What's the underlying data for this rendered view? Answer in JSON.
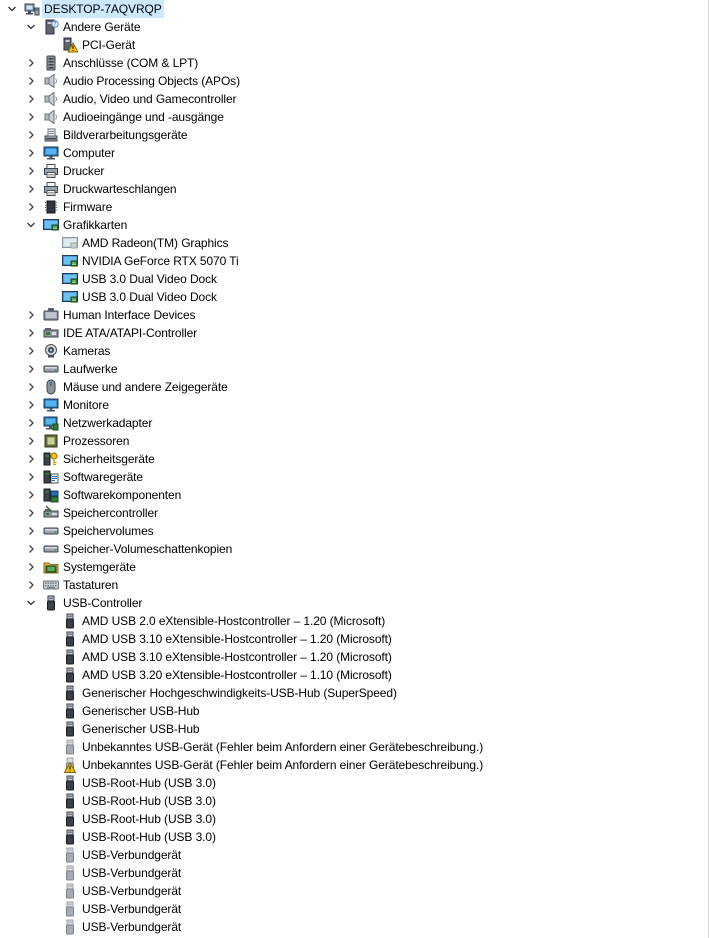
{
  "root": {
    "label": "DESKTOP-7AQVRQP",
    "icon": "computer-network-icon",
    "expanded": true
  },
  "tree": [
    {
      "label": "Andere Geräte",
      "icon": "unknown-device-icon",
      "expanded": true,
      "children": [
        {
          "label": "PCI-Gerät",
          "icon": "warning-device-icon"
        }
      ]
    },
    {
      "label": "Anschlüsse (COM & LPT)",
      "icon": "port-icon"
    },
    {
      "label": "Audio Processing Objects (APOs)",
      "icon": "speaker-icon"
    },
    {
      "label": "Audio, Video und Gamecontroller",
      "icon": "speaker-icon"
    },
    {
      "label": "Audioeingänge und -ausgänge",
      "icon": "speaker-icon"
    },
    {
      "label": "Bildverarbeitungsgeräte",
      "icon": "scanner-icon"
    },
    {
      "label": "Computer",
      "icon": "monitor-icon"
    },
    {
      "label": "Drucker",
      "icon": "printer-icon"
    },
    {
      "label": "Druckwarteschlangen",
      "icon": "printer-icon"
    },
    {
      "label": "Firmware",
      "icon": "chip-icon"
    },
    {
      "label": "Grafikkarten",
      "icon": "display-adapter-icon",
      "expanded": true,
      "children": [
        {
          "label": "AMD Radeon(TM) Graphics",
          "icon": "display-adapter-disabled-icon"
        },
        {
          "label": "NVIDIA GeForce RTX 5070 Ti",
          "icon": "display-adapter-icon"
        },
        {
          "label": "USB 3.0 Dual Video Dock",
          "icon": "display-adapter-icon"
        },
        {
          "label": "USB 3.0 Dual Video Dock",
          "icon": "display-adapter-icon"
        }
      ]
    },
    {
      "label": "Human Interface Devices",
      "icon": "hid-icon"
    },
    {
      "label": "IDE ATA/ATAPI-Controller",
      "icon": "ide-controller-icon"
    },
    {
      "label": "Kameras",
      "icon": "camera-icon"
    },
    {
      "label": "Laufwerke",
      "icon": "drive-icon"
    },
    {
      "label": "Mäuse und andere Zeigegeräte",
      "icon": "mouse-icon"
    },
    {
      "label": "Monitore",
      "icon": "monitor-icon"
    },
    {
      "label": "Netzwerkadapter",
      "icon": "network-icon"
    },
    {
      "label": "Prozessoren",
      "icon": "processor-icon"
    },
    {
      "label": "Sicherheitsgeräte",
      "icon": "security-key-icon"
    },
    {
      "label": "Softwaregeräte",
      "icon": "software-device-icon"
    },
    {
      "label": "Softwarekomponenten",
      "icon": "software-component-icon"
    },
    {
      "label": "Speichercontroller",
      "icon": "storage-controller-icon"
    },
    {
      "label": "Speichervolumes",
      "icon": "drive-icon"
    },
    {
      "label": "Speicher-Volumeschattenkopien",
      "icon": "drive-icon"
    },
    {
      "label": "Systemgeräte",
      "icon": "system-folder-icon"
    },
    {
      "label": "Tastaturen",
      "icon": "keyboard-icon"
    },
    {
      "label": "USB-Controller",
      "icon": "usb-icon",
      "expanded": true,
      "children": [
        {
          "label": "AMD USB 2.0 eXtensible-Hostcontroller – 1.20 (Microsoft)",
          "icon": "usb-icon"
        },
        {
          "label": "AMD USB 3.10 eXtensible-Hostcontroller – 1.20 (Microsoft)",
          "icon": "usb-icon"
        },
        {
          "label": "AMD USB 3.10 eXtensible-Hostcontroller – 1.20 (Microsoft)",
          "icon": "usb-icon"
        },
        {
          "label": "AMD USB 3.20 eXtensible-Hostcontroller – 1.10 (Microsoft)",
          "icon": "usb-icon"
        },
        {
          "label": "Generischer Hochgeschwindigkeits-USB-Hub (SuperSpeed)",
          "icon": "usb-icon"
        },
        {
          "label": "Generischer USB-Hub",
          "icon": "usb-icon"
        },
        {
          "label": "Generischer USB-Hub",
          "icon": "usb-icon"
        },
        {
          "label": "Unbekanntes USB-Gerät (Fehler beim Anfordern einer Gerätebeschreibung.)",
          "icon": "usb-disabled-icon"
        },
        {
          "label": "Unbekanntes USB-Gerät (Fehler beim Anfordern einer Gerätebeschreibung.)",
          "icon": "usb-warning-icon"
        },
        {
          "label": "USB-Root-Hub (USB 3.0)",
          "icon": "usb-icon"
        },
        {
          "label": "USB-Root-Hub (USB 3.0)",
          "icon": "usb-icon"
        },
        {
          "label": "USB-Root-Hub (USB 3.0)",
          "icon": "usb-icon"
        },
        {
          "label": "USB-Root-Hub (USB 3.0)",
          "icon": "usb-icon"
        },
        {
          "label": "USB-Verbundgerät",
          "icon": "usb-disabled-icon"
        },
        {
          "label": "USB-Verbundgerät",
          "icon": "usb-disabled-icon"
        },
        {
          "label": "USB-Verbundgerät",
          "icon": "usb-disabled-icon"
        },
        {
          "label": "USB-Verbundgerät",
          "icon": "usb-disabled-icon"
        },
        {
          "label": "USB-Verbundgerät",
          "icon": "usb-disabled-icon"
        }
      ]
    }
  ]
}
